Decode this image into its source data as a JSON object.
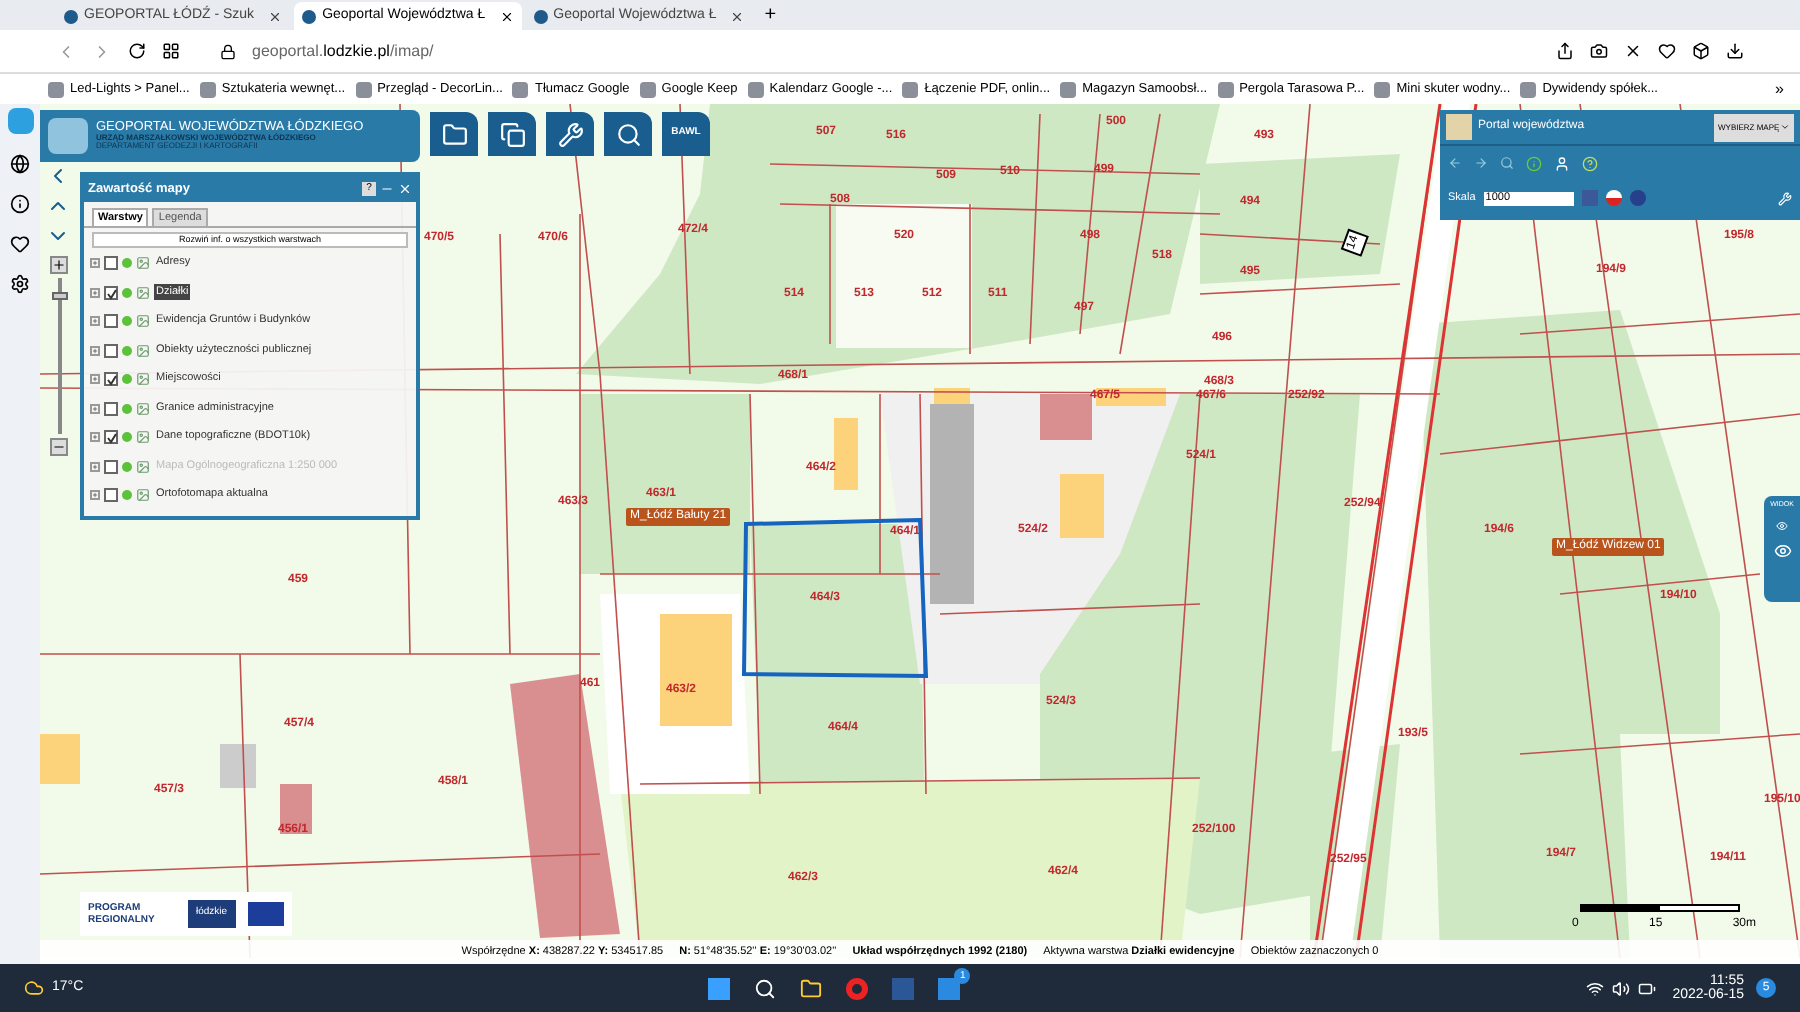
{
  "browser": {
    "tabs": [
      {
        "label": "GEOPORTAL ŁÓDŹ - Szuk",
        "selected": false
      },
      {
        "label": "Geoportal Województwa Ł",
        "selected": true
      },
      {
        "label": "Geoportal Województwa Ł",
        "selected": false
      }
    ],
    "new_tab": "+",
    "url_host": "geoportal.",
    "url_domain": "lodzkie.pl",
    "url_path": "/imap/",
    "bookmarks": [
      "Led-Lights > Panel...",
      "Sztukateria wewnęt...",
      "Przegląd - DecorLin...",
      "Tłumacz Google",
      "Google Keep",
      "Kalendarz Google -...",
      "Łączenie PDF, onlin...",
      "Magazyn Samoobsł...",
      "Pergola Tarasowa P...",
      "Mini skuter wodny...",
      "Dywidendy spółek..."
    ],
    "bookmarks_more": "»"
  },
  "header": {
    "title": "GEOPORTAL WOJEWÓDZTWA ŁÓDZKIEGO",
    "subtitle": "URZĄD MARSZAŁKOWSKI WOJEWÓDZTWA ŁÓDZKIEGO",
    "department": "DEPARTAMENT GEODEZJI I KARTOGRAFII"
  },
  "toolbar": {
    "text_button": "BAWL"
  },
  "layers_panel": {
    "title": "Zawartość mapy",
    "help": "?",
    "tabs": [
      {
        "label": "Warstwy",
        "selected": true
      },
      {
        "label": "Legenda",
        "selected": false
      }
    ],
    "expand_button": "Rozwiń inf. o wszystkich warstwach",
    "layers": [
      {
        "name": "Adresy",
        "checked": false,
        "selected": false,
        "disabled": false
      },
      {
        "name": "Działki",
        "checked": true,
        "selected": true,
        "disabled": false
      },
      {
        "name": "Ewidencja Gruntów i Budynków",
        "checked": false,
        "selected": false,
        "disabled": false
      },
      {
        "name": "Obiekty użyteczności publicznej",
        "checked": false,
        "selected": false,
        "disabled": false
      },
      {
        "name": "Miejscowości",
        "checked": true,
        "selected": false,
        "disabled": false
      },
      {
        "name": "Granice administracyjne",
        "checked": false,
        "selected": false,
        "disabled": false
      },
      {
        "name": "Dane topograficzne (BDOT10k)",
        "checked": true,
        "selected": false,
        "disabled": false
      },
      {
        "name": "Mapa Ogólnogeograficzna 1:250 000",
        "checked": false,
        "selected": false,
        "disabled": true
      },
      {
        "name": "Ortofotomapa aktualna",
        "checked": false,
        "selected": false,
        "disabled": false
      }
    ]
  },
  "right_panel": {
    "title": "Portal województwa",
    "map_select": "WYBIERZ MAPĘ",
    "scale_label": "Skala",
    "scale_value": "1000"
  },
  "view_panel": {
    "title": "WIDOK"
  },
  "zoom_slider": {
    "level": 0.9
  },
  "map": {
    "parcels": [
      "470/5",
      "470/6",
      "472/4",
      "507",
      "516",
      "509",
      "510",
      "500",
      "499",
      "493",
      "508",
      "498",
      "494",
      "520",
      "518",
      "514",
      "513",
      "512",
      "511",
      "497",
      "495",
      "496",
      "468/1",
      "468/3",
      "467/5",
      "467/6",
      "252/92",
      "464/2",
      "524/1",
      "463/1",
      "463/3",
      "252/94",
      "464/1",
      "524/2",
      "464/3",
      "461",
      "463/2",
      "524/3",
      "464/4",
      "458/1",
      "193/5",
      "462/3",
      "462/4",
      "252/100",
      "252/95",
      "194/9",
      "195/8",
      "194/6",
      "194/10",
      "194/7",
      "194/11",
      "195/10",
      "459",
      "457/3",
      "457/4",
      "456/1"
    ],
    "places": [
      "M_Łódź Bałuty 21",
      "M_Łódź Widzew 01"
    ],
    "road_number": "14"
  },
  "logos": {
    "program": "PROGRAM REGIONALNY",
    "region": "łódzkie"
  },
  "status": [
    {
      "text": "Współrzędne **X:** 438287.22 **Y:** 534517.85",
      "bold": false
    },
    {
      "text": "**N:** 51°48'35.52'' **E:** 19°30'03.02''",
      "bold": false
    },
    {
      "text": "Układ współrzędnych 1992 (2180)",
      "bold": true
    },
    {
      "text": "Aktywna warstwa **Działki ewidencyjne**",
      "bold": false
    },
    {
      "text": "Obiektów zaznaczonych 0",
      "bold": false
    }
  ],
  "scale_bar": [
    "0",
    "15",
    "30m"
  ],
  "taskbar": {
    "weather": "17°C",
    "time": "11:55",
    "date": "2022-06-15",
    "mail_badge": "1",
    "notifications": "5"
  }
}
